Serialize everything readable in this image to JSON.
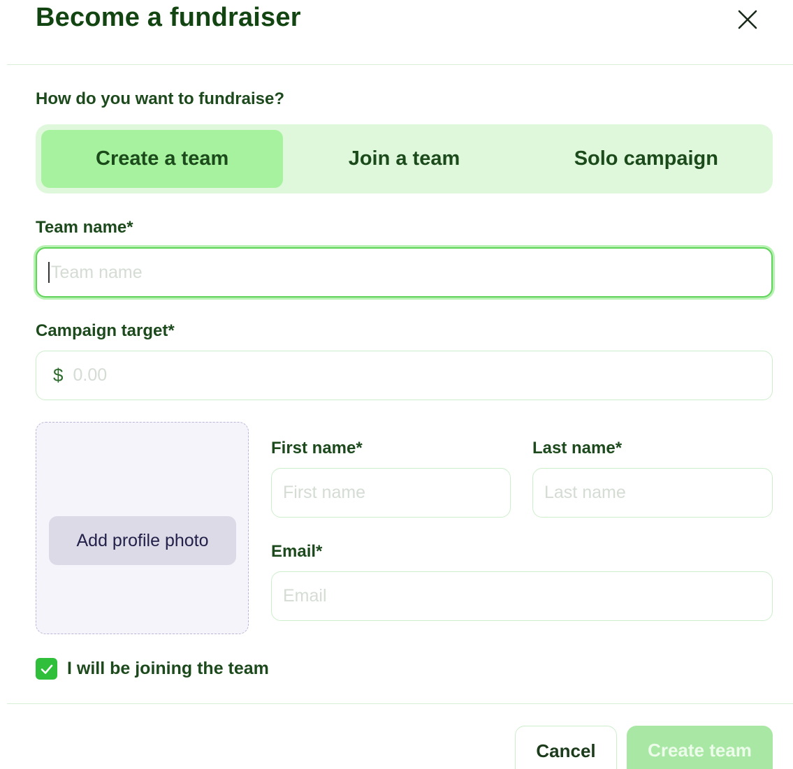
{
  "dialog": {
    "title": "Become a fundraiser",
    "close_icon": "close-icon"
  },
  "mode": {
    "question": "How do you want to fundraise?",
    "options": [
      "Create a team",
      "Join a team",
      "Solo campaign"
    ],
    "selected": "Create a team"
  },
  "team_name": {
    "label": "Team name*",
    "placeholder": "Team name",
    "value": ""
  },
  "campaign_target": {
    "label": "Campaign target*",
    "currency": "$",
    "placeholder": "0.00",
    "value": ""
  },
  "profile_photo": {
    "button_label": "Add profile photo"
  },
  "first_name": {
    "label": "First name*",
    "placeholder": "First name",
    "value": ""
  },
  "last_name": {
    "label": "Last name*",
    "placeholder": "Last name",
    "value": ""
  },
  "email": {
    "label": "Email*",
    "placeholder": "Email",
    "value": ""
  },
  "joining": {
    "label": "I will be joining the team",
    "checked": true
  },
  "actions": {
    "cancel_label": "Cancel",
    "create_label": "Create team"
  },
  "colors": {
    "accent": "#a7f29e",
    "primary_text": "#124512",
    "checkbox": "#2fbf3a"
  }
}
